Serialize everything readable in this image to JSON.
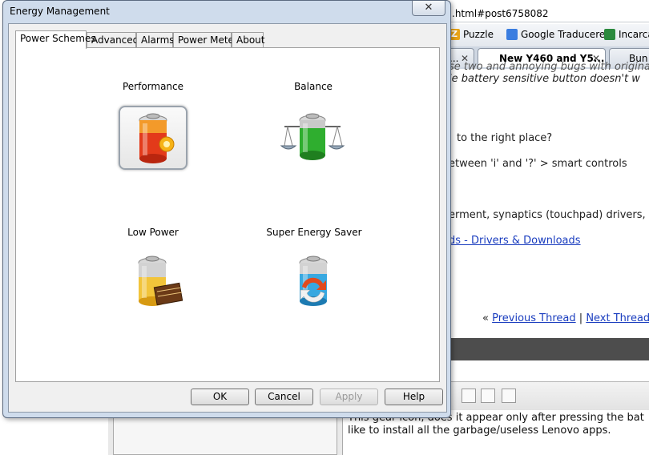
{
  "browser": {
    "address": ".html#post6758082",
    "bookmarks": [
      {
        "label": "Puzzle",
        "icon": "puzzle-z-icon",
        "color": "#e8a317"
      },
      {
        "label": "Google Traducere",
        "icon": "google-translate-icon",
        "color": "#3a7de0"
      },
      {
        "label": "Incarca",
        "icon": "incarca-icon",
        "color": "#2b8a3e"
      }
    ],
    "tabs": [
      {
        "label": "..."
      },
      {
        "label": "New Y460 and Y5..."
      },
      {
        "label": "Bun"
      }
    ],
    "content": {
      "line1": "se two and annoying bugs with original,",
      "line2": "le battery sensitive button doesn't w",
      "line3": "to the right place?",
      "line4": "etween 'i' and '?' > smart controls",
      "line5": "erment, synaptics (touchpad) drivers,",
      "link1": "ds - Drivers & Downloads",
      "prev_quote": "«",
      "prev_thread": "Previous Thread",
      "sep": "|",
      "next_thread": "Next Thread",
      "next_quote": "»"
    },
    "reply": {
      "line1": "This gear icon, does it appear only after pressing the bat",
      "line2": "like to install all the garbage/useless Lenovo apps."
    }
  },
  "dialog": {
    "title": "Energy Management",
    "close": "✕",
    "tabs": [
      "Power Schemes",
      "Advanced",
      "Alarms",
      "Power Meter",
      "About"
    ],
    "schemes": [
      {
        "label": "Performance",
        "icon": "performance-battery-icon",
        "selected": true
      },
      {
        "label": "Balance",
        "icon": "balance-battery-icon",
        "selected": false
      },
      {
        "label": "Low Power",
        "icon": "low-power-battery-icon",
        "selected": false
      },
      {
        "label": "Super Energy Saver",
        "icon": "super-energy-saver-battery-icon",
        "selected": false
      }
    ],
    "buttons": {
      "ok": "OK",
      "cancel": "Cancel",
      "apply": "Apply",
      "help": "Help"
    }
  }
}
